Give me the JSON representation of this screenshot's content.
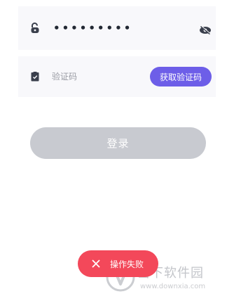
{
  "password_field": {
    "masked_value": "•••••••••",
    "lock_icon": "lock-icon",
    "toggle_icon": "eye-off-icon"
  },
  "code_field": {
    "placeholder": "验证码",
    "icon": "verify-code-icon",
    "get_code_label": "获取验证码"
  },
  "login": {
    "label": "登录"
  },
  "toast": {
    "icon": "close-icon",
    "message": "操作失败"
  },
  "watermark": {
    "title": "当下软件园",
    "url": "www.downxia.com"
  },
  "colors": {
    "accent": "#6d5ee8",
    "login_disabled": "#c8cad0",
    "toast_error": "#f3485a",
    "field_bg": "#f8f8fb"
  }
}
